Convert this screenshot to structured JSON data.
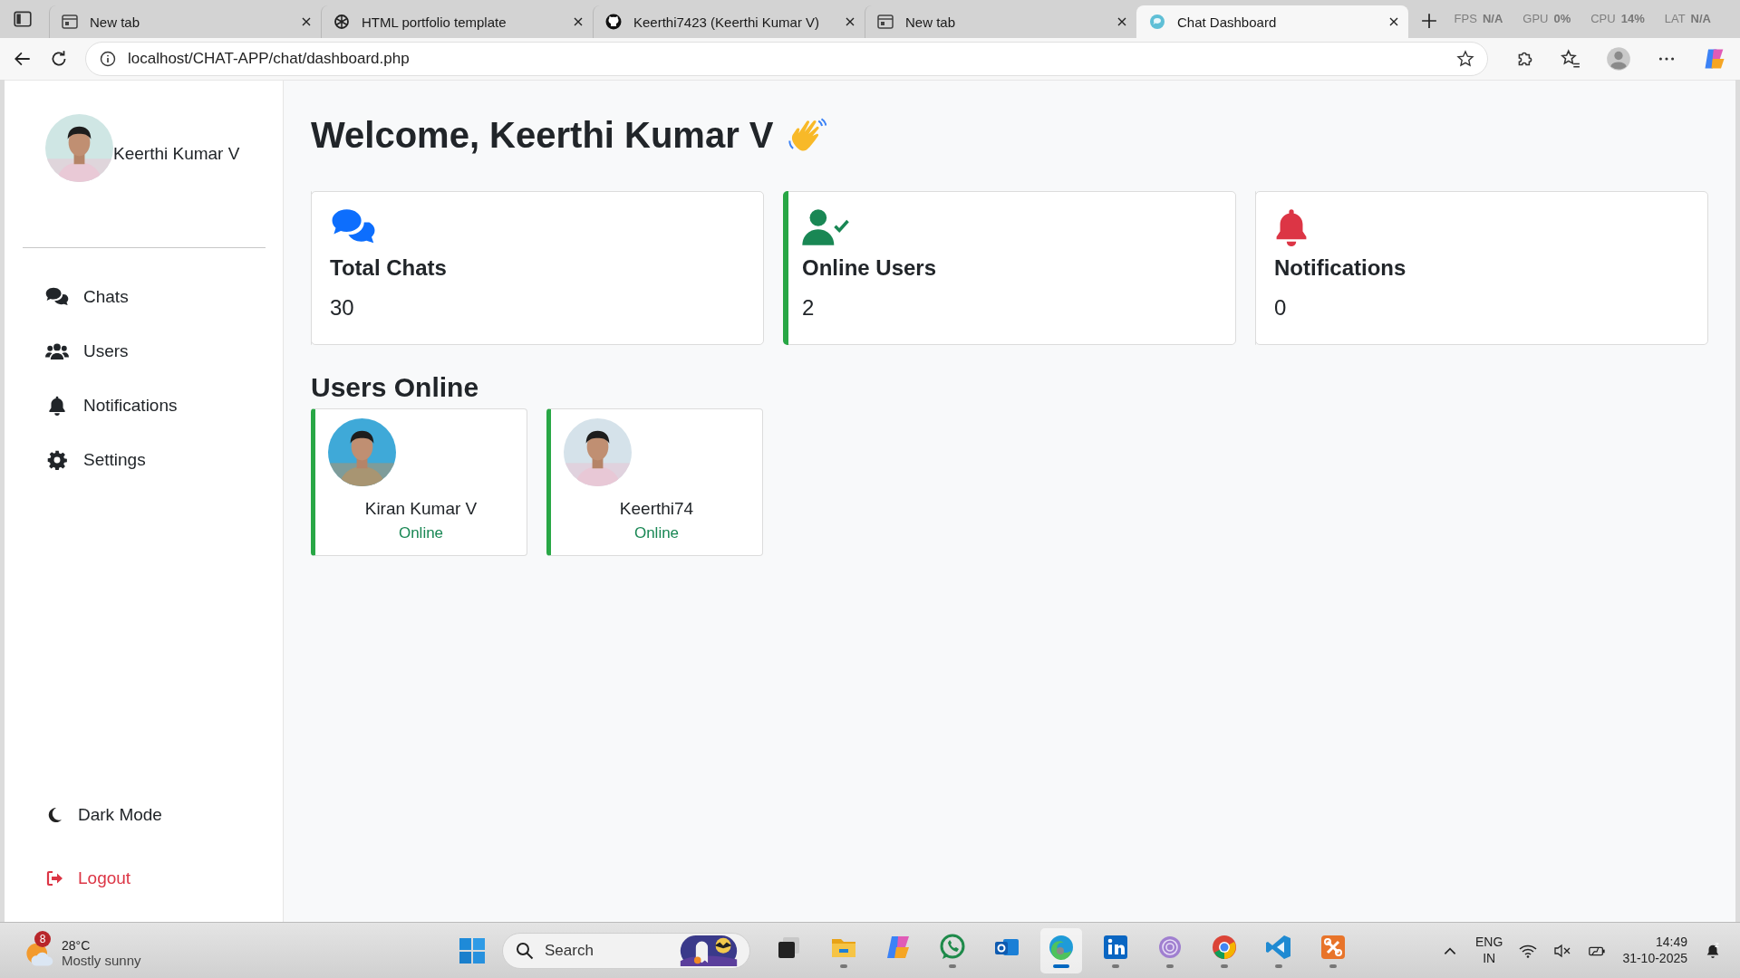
{
  "browser": {
    "tabs": [
      {
        "title": "New tab",
        "kind": "newtab",
        "selected": false
      },
      {
        "title": "HTML portfolio template",
        "kind": "openai",
        "selected": false
      },
      {
        "title": "Keerthi7423 (Keerthi Kumar V)",
        "kind": "github",
        "selected": false
      },
      {
        "title": "New tab",
        "kind": "newtab",
        "selected": false
      },
      {
        "title": "Chat Dashboard",
        "kind": "site",
        "selected": true
      }
    ],
    "overlay": [
      {
        "label": "FPS",
        "value": "N/A"
      },
      {
        "label": "GPU",
        "value": "0%"
      },
      {
        "label": "CPU",
        "value": "14%"
      },
      {
        "label": "LAT",
        "value": "N/A"
      }
    ],
    "url": "localhost/CHAT-APP/chat/dashboard.php"
  },
  "sidebar": {
    "user_name": "Keerthi Kumar V",
    "nav": [
      {
        "label": "Chats",
        "kind": "chats"
      },
      {
        "label": "Users",
        "kind": "users"
      },
      {
        "label": "Notifications",
        "kind": "bell"
      },
      {
        "label": "Settings",
        "kind": "gear"
      }
    ],
    "dark_mode": "Dark Mode",
    "logout": "Logout"
  },
  "main": {
    "heading": "Welcome, Keerthi Kumar V",
    "stats": [
      {
        "title": "Total Chats",
        "value": "30",
        "kind": "chats",
        "highlighted": false
      },
      {
        "title": "Online Users",
        "value": "2",
        "kind": "user-check",
        "highlighted": true
      },
      {
        "title": "Notifications",
        "value": "0",
        "kind": "bell",
        "highlighted": false
      }
    ],
    "users_heading": "Users Online",
    "users": [
      {
        "name": "Kiran Kumar V",
        "status": "Online",
        "online": true
      },
      {
        "name": "Keerthi74",
        "status": "Online",
        "online": true
      }
    ]
  },
  "taskbar": {
    "weather": {
      "badge": "8",
      "temp": "28°C",
      "condition": "Mostly sunny"
    },
    "search": {
      "placeholder": "Search"
    },
    "apps": [
      {
        "kind": "taskview",
        "running": false,
        "selected": false
      },
      {
        "kind": "folder",
        "running": true,
        "selected": false
      },
      {
        "kind": "copilot",
        "running": false,
        "selected": false
      },
      {
        "kind": "whatsapp",
        "running": true,
        "selected": false
      },
      {
        "kind": "outlook",
        "running": false,
        "selected": false
      },
      {
        "kind": "edge",
        "running": true,
        "selected": true
      },
      {
        "kind": "linkedin",
        "running": true,
        "selected": false
      },
      {
        "kind": "tor",
        "running": true,
        "selected": false
      },
      {
        "kind": "chrome",
        "running": true,
        "selected": false
      },
      {
        "kind": "vscode",
        "running": true,
        "selected": false
      },
      {
        "kind": "xampp",
        "running": true,
        "selected": false
      }
    ],
    "language": "ENG",
    "region": "IN",
    "time": "14:49",
    "date": "31-10-2025"
  }
}
